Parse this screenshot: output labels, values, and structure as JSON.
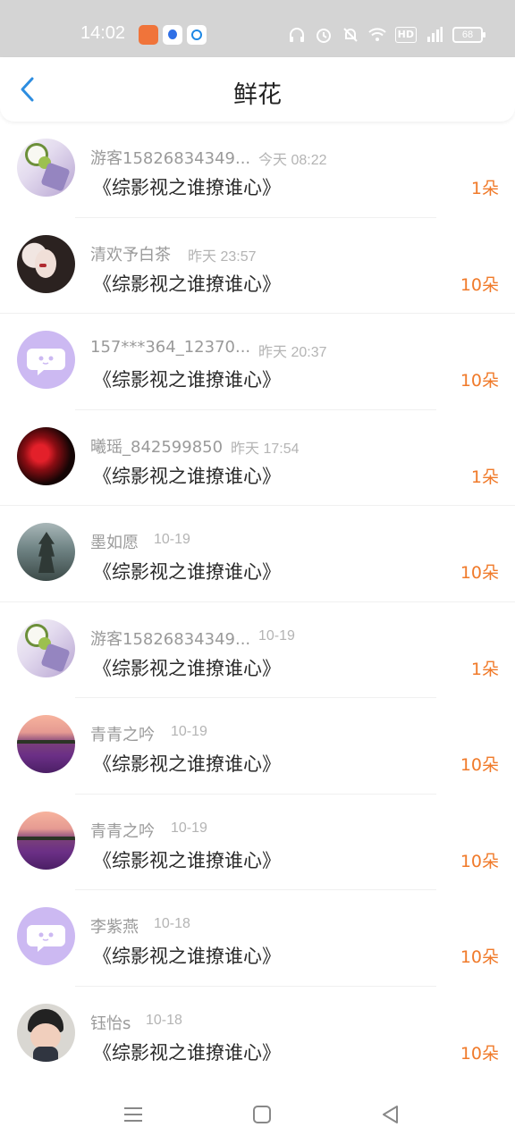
{
  "status_bar": {
    "time": "14:02",
    "hd_label": "HD",
    "battery": "68",
    "icons": [
      "app-orange-icon",
      "baidu-paw-icon",
      "blue-app-icon",
      "headphones-icon",
      "alarm-icon",
      "mute-bell-icon",
      "wifi-icon",
      "hd-icon",
      "signal-4g-icon",
      "battery-icon"
    ]
  },
  "header": {
    "title": "鲜花",
    "back_icon": "chevron-left-icon",
    "accent_color": "#2d8de0"
  },
  "colors": {
    "count": "#f07a2a",
    "username": "#9a9a9a",
    "time": "#b4b4b4",
    "book": "#2a2a2a"
  },
  "items": [
    {
      "user": "游客15826834349...",
      "time": "今天 08:22",
      "book": "《综影视之谁撩谁心》",
      "count": "1朵",
      "avatar": "flower-vase-avatar"
    },
    {
      "user": "清欢予白茶",
      "time": "昨天 23:57",
      "book": "《综影视之谁撩谁心》",
      "count": "10朵",
      "avatar": "girl-portrait-avatar"
    },
    {
      "user": "157***364_12370...",
      "time": "昨天 20:37",
      "book": "《综影视之谁撩谁心》",
      "count": "10朵",
      "avatar": "chat-bubble-avatar"
    },
    {
      "user": "曦瑶_842599850",
      "time": "昨天 17:54",
      "book": "《综影视之谁撩谁心》",
      "count": "1朵",
      "avatar": "red-spider-lily-avatar"
    },
    {
      "user": "墨如愿",
      "time": "10-19",
      "book": "《综影视之谁撩谁心》",
      "count": "10朵",
      "avatar": "pagoda-avatar"
    },
    {
      "user": "游客15826834349...",
      "time": "10-19",
      "book": "《综影视之谁撩谁心》",
      "count": "1朵",
      "avatar": "flower-vase-avatar"
    },
    {
      "user": "青青之吟",
      "time": "10-19",
      "book": "《综影视之谁撩谁心》",
      "count": "10朵",
      "avatar": "lavender-field-avatar"
    },
    {
      "user": "青青之吟",
      "time": "10-19",
      "book": "《综影视之谁撩谁心》",
      "count": "10朵",
      "avatar": "lavender-field-avatar"
    },
    {
      "user": "李紫燕",
      "time": "10-18",
      "book": "《综影视之谁撩谁心》",
      "count": "10朵",
      "avatar": "chat-bubble-avatar"
    },
    {
      "user": "钰怡s",
      "time": "10-18",
      "book": "《综影视之谁撩谁心》",
      "count": "10朵",
      "avatar": "cartoon-girl-avatar"
    }
  ],
  "nav_bar": {
    "buttons": [
      "menu-icon",
      "home-square-icon",
      "back-triangle-icon"
    ]
  }
}
